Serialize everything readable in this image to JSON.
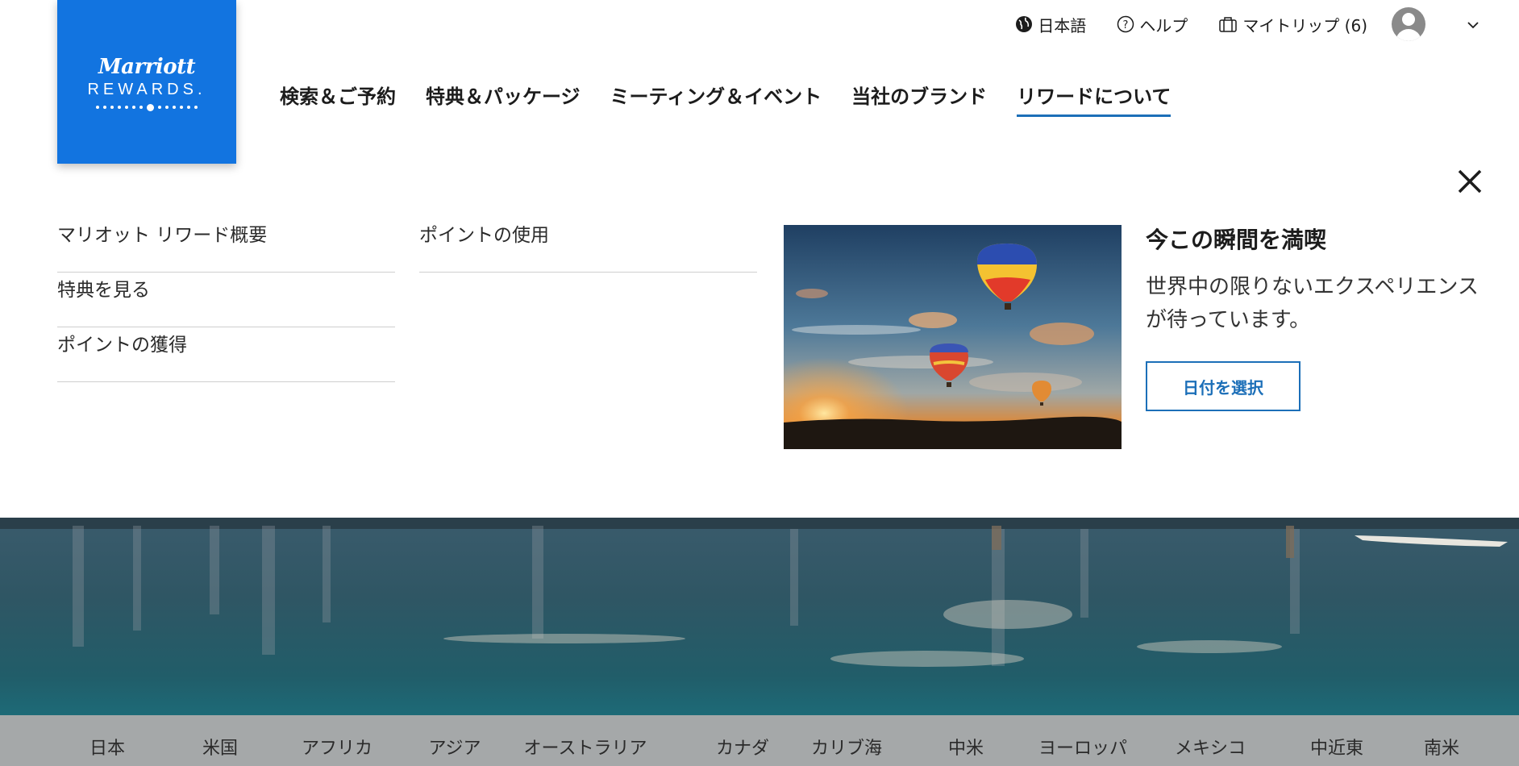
{
  "header": {
    "language": "日本語",
    "help": "ヘルプ",
    "my_trips": "マイトリップ (6)"
  },
  "logo": {
    "brand": "Marriott",
    "program": "REWARDS."
  },
  "nav": {
    "items": [
      {
        "label": "検索＆ご予約"
      },
      {
        "label": "特典＆パッケージ"
      },
      {
        "label": "ミーティング＆イベント"
      },
      {
        "label": "当社のブランド"
      },
      {
        "label": "リワードについて"
      }
    ],
    "active_index": 4
  },
  "menu": {
    "column1": [
      {
        "label": "マリオット リワード概要"
      },
      {
        "label": "特典を見る"
      },
      {
        "label": "ポイントの獲得"
      }
    ],
    "column2": [
      {
        "label": "ポイントの使用"
      }
    ]
  },
  "promo": {
    "title": "今この瞬間を満喫",
    "description": "世界中の限りないエクスペリエンスが待っています。",
    "button": "日付を選択"
  },
  "regions": [
    {
      "label": "日本"
    },
    {
      "label": "米国"
    },
    {
      "label": "アフリカ"
    },
    {
      "label": "アジア"
    },
    {
      "label": "オーストラリア"
    },
    {
      "label": "カナダ"
    },
    {
      "label": "カリブ海"
    },
    {
      "label": "中米"
    },
    {
      "label": "ヨーロッパ"
    },
    {
      "label": "メキシコ"
    },
    {
      "label": "中近東"
    },
    {
      "label": "南米"
    }
  ],
  "colors": {
    "brand_blue": "#1274e0",
    "link_blue": "#1c6fb8",
    "region_bar": "#a5a8a9"
  }
}
